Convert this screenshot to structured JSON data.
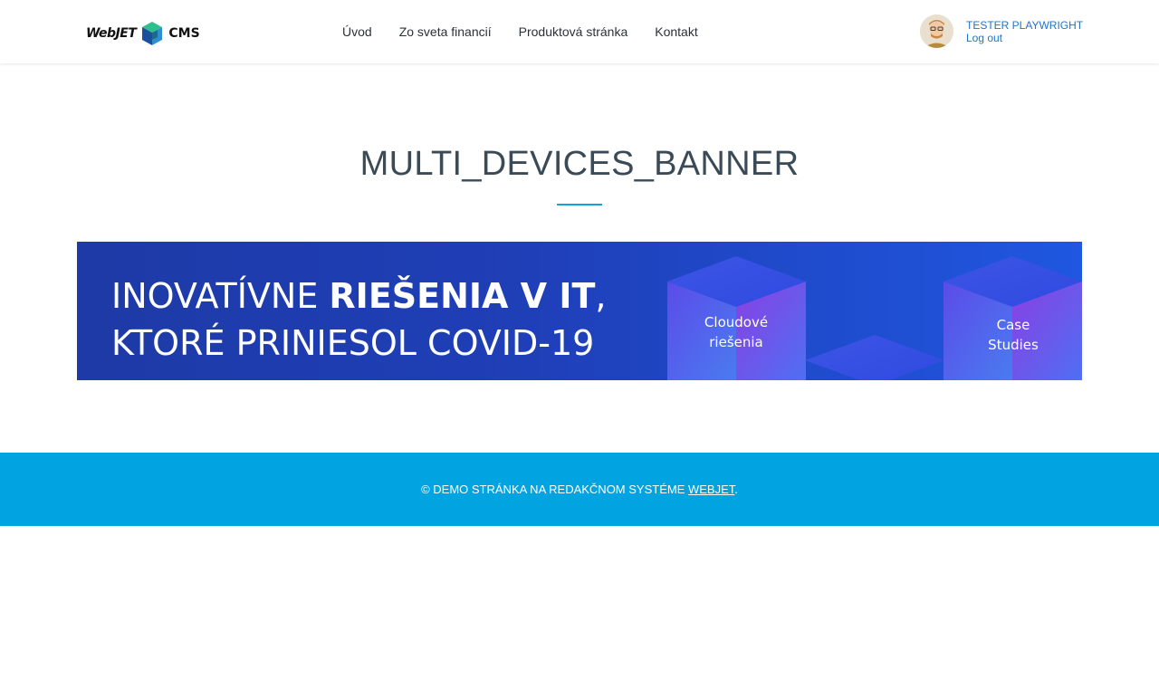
{
  "header": {
    "logo": {
      "left_text": "WebJET",
      "right_text": "CMS",
      "icon": "webjet-logo-mark"
    },
    "nav": [
      {
        "label": "Úvod"
      },
      {
        "label": "Zo sveta financií"
      },
      {
        "label": "Produktová stránka"
      },
      {
        "label": "Kontakt"
      }
    ],
    "user": {
      "name": "TESTER PLAYWRIGHT",
      "logout": "Log out",
      "avatar_icon": "user-avatar"
    }
  },
  "main": {
    "title": "MULTI_DEVICES_BANNER",
    "accent_color": "#14a0d8",
    "banner": {
      "line1_light": "INOVATÍVNE ",
      "line1_bold": "RIEŠENIA V IT",
      "line1_tail": ",",
      "line2": "KTORÉ PRINIESOL COVID-19",
      "cube1_label_a": "Cloudové",
      "cube1_label_b": "riešenia",
      "cube2_label_a": "Case",
      "cube2_label_b": "Studies"
    }
  },
  "footer": {
    "text": "© DEMO STRÁNKA NA REDAKČNOM SYSTÉME ",
    "link": "WEBJET",
    "tail": ".",
    "background": "#02a3e1"
  }
}
